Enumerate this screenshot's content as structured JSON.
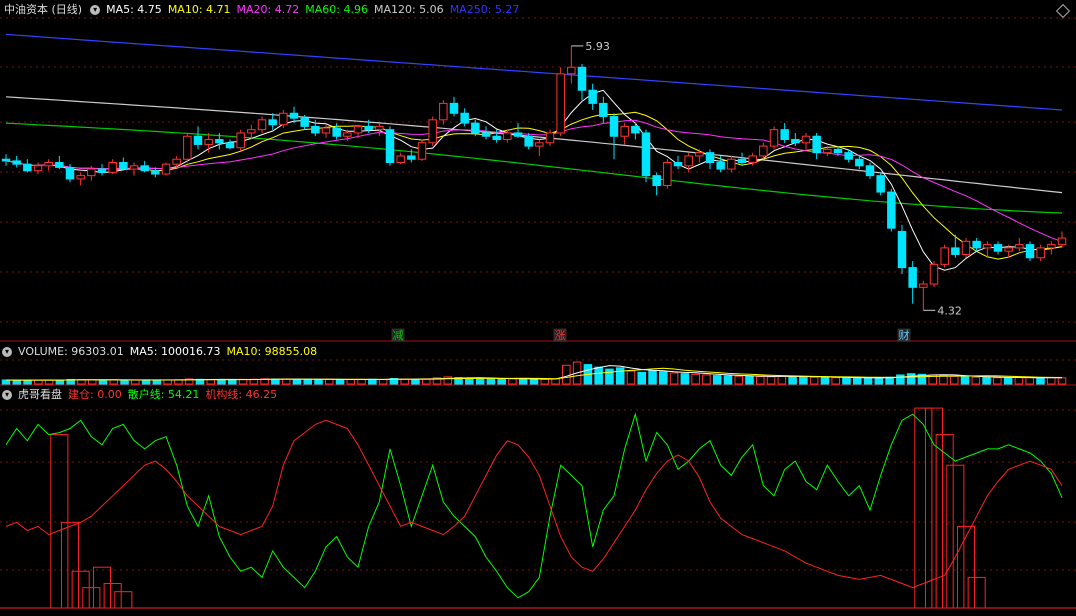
{
  "main": {
    "name": "中油资本 (日线)",
    "ma": [
      {
        "label": "MA5: 4.75",
        "color": "#ffffff"
      },
      {
        "label": "MA10: 4.71",
        "color": "#ffff00"
      },
      {
        "label": "MA20: 4.72",
        "color": "#ff33ff"
      },
      {
        "label": "MA60: 4.96",
        "color": "#00ff00"
      },
      {
        "label": "MA120: 5.06",
        "color": "#cccccc"
      },
      {
        "label": "MA250: 5.27",
        "color": "#3333ff"
      }
    ],
    "high_label": "5.93",
    "low_label": "4.32",
    "markers": [
      {
        "text": "减",
        "color": "#00cc00"
      },
      {
        "text": "涨",
        "color": "#ff3333"
      },
      {
        "text": "财",
        "color": "#66ccff"
      }
    ]
  },
  "volume": {
    "title": "VOLUME: 96303.01",
    "ma5": "MA5: 100016.73",
    "ma10": "MA10: 98855.08"
  },
  "indicator": {
    "title": "虎哥看盘",
    "jc": "建仓: 0.00",
    "sh": "散户线: 54.21",
    "jg": "机构线: 46.25"
  },
  "chart_data": [
    {
      "type": "candlestick",
      "title": "中油资本 (日线)",
      "ylim": [
        4.2,
        6.1
      ],
      "annotations": [
        {
          "label": "5.93",
          "value": 5.93
        },
        {
          "label": "4.32",
          "value": 4.32
        }
      ],
      "candles": [
        [
          5.24,
          5.27,
          5.2,
          5.23
        ],
        [
          5.23,
          5.26,
          5.19,
          5.21
        ],
        [
          5.21,
          5.24,
          5.16,
          5.17
        ],
        [
          5.17,
          5.22,
          5.15,
          5.2
        ],
        [
          5.2,
          5.24,
          5.17,
          5.22
        ],
        [
          5.22,
          5.26,
          5.18,
          5.19
        ],
        [
          5.19,
          5.21,
          5.1,
          5.12
        ],
        [
          5.12,
          5.16,
          5.08,
          5.14
        ],
        [
          5.14,
          5.2,
          5.11,
          5.18
        ],
        [
          5.18,
          5.21,
          5.14,
          5.16
        ],
        [
          5.16,
          5.24,
          5.15,
          5.22
        ],
        [
          5.22,
          5.25,
          5.17,
          5.18
        ],
        [
          5.18,
          5.22,
          5.14,
          5.2
        ],
        [
          5.2,
          5.23,
          5.16,
          5.17
        ],
        [
          5.17,
          5.19,
          5.13,
          5.15
        ],
        [
          5.15,
          5.22,
          5.14,
          5.21
        ],
        [
          5.21,
          5.26,
          5.19,
          5.24
        ],
        [
          5.24,
          5.4,
          5.22,
          5.38
        ],
        [
          5.38,
          5.44,
          5.3,
          5.33
        ],
        [
          5.33,
          5.4,
          5.28,
          5.36
        ],
        [
          5.36,
          5.4,
          5.3,
          5.34
        ],
        [
          5.34,
          5.36,
          5.3,
          5.31
        ],
        [
          5.31,
          5.42,
          5.29,
          5.4
        ],
        [
          5.4,
          5.45,
          5.36,
          5.42
        ],
        [
          5.42,
          5.5,
          5.4,
          5.48
        ],
        [
          5.48,
          5.52,
          5.42,
          5.45
        ],
        [
          5.45,
          5.54,
          5.43,
          5.52
        ],
        [
          5.52,
          5.56,
          5.46,
          5.49
        ],
        [
          5.49,
          5.51,
          5.42,
          5.44
        ],
        [
          5.44,
          5.48,
          5.38,
          5.4
        ],
        [
          5.4,
          5.45,
          5.37,
          5.43
        ],
        [
          5.43,
          5.46,
          5.36,
          5.38
        ],
        [
          5.38,
          5.42,
          5.35,
          5.4
        ],
        [
          5.4,
          5.45,
          5.37,
          5.44
        ],
        [
          5.44,
          5.48,
          5.4,
          5.42
        ],
        [
          5.42,
          5.46,
          5.38,
          5.44
        ],
        [
          5.42,
          5.44,
          5.2,
          5.22
        ],
        [
          5.22,
          5.28,
          5.21,
          5.26
        ],
        [
          5.26,
          5.3,
          5.22,
          5.24
        ],
        [
          5.24,
          5.36,
          5.23,
          5.34
        ],
        [
          5.34,
          5.5,
          5.32,
          5.48
        ],
        [
          5.48,
          5.6,
          5.45,
          5.58
        ],
        [
          5.58,
          5.62,
          5.5,
          5.52
        ],
        [
          5.52,
          5.55,
          5.44,
          5.46
        ],
        [
          5.46,
          5.48,
          5.38,
          5.4
        ],
        [
          5.4,
          5.44,
          5.36,
          5.38
        ],
        [
          5.38,
          5.42,
          5.34,
          5.36
        ],
        [
          5.36,
          5.42,
          5.34,
          5.4
        ],
        [
          5.4,
          5.46,
          5.37,
          5.38
        ],
        [
          5.38,
          5.4,
          5.3,
          5.32
        ],
        [
          5.32,
          5.36,
          5.26,
          5.34
        ],
        [
          5.34,
          5.42,
          5.32,
          5.4
        ],
        [
          5.4,
          5.8,
          5.38,
          5.76
        ],
        [
          5.76,
          5.93,
          5.7,
          5.8
        ],
        [
          5.8,
          5.82,
          5.6,
          5.66
        ],
        [
          5.66,
          5.7,
          5.54,
          5.58
        ],
        [
          5.58,
          5.62,
          5.46,
          5.5
        ],
        [
          5.5,
          5.52,
          5.24,
          5.38
        ],
        [
          5.38,
          5.46,
          5.33,
          5.44
        ],
        [
          5.44,
          5.46,
          5.36,
          5.4
        ],
        [
          5.4,
          5.42,
          5.1,
          5.14
        ],
        [
          5.14,
          5.16,
          5.02,
          5.08
        ],
        [
          5.08,
          5.24,
          5.06,
          5.22
        ],
        [
          5.22,
          5.26,
          5.18,
          5.2
        ],
        [
          5.2,
          5.28,
          5.16,
          5.26
        ],
        [
          5.26,
          5.3,
          5.22,
          5.28
        ],
        [
          5.28,
          5.3,
          5.18,
          5.22
        ],
        [
          5.22,
          5.26,
          5.16,
          5.18
        ],
        [
          5.18,
          5.26,
          5.16,
          5.24
        ],
        [
          5.24,
          5.28,
          5.2,
          5.22
        ],
        [
          5.22,
          5.28,
          5.2,
          5.26
        ],
        [
          5.26,
          5.34,
          5.24,
          5.32
        ],
        [
          5.32,
          5.44,
          5.3,
          5.42
        ],
        [
          5.42,
          5.46,
          5.34,
          5.36
        ],
        [
          5.36,
          5.4,
          5.32,
          5.34
        ],
        [
          5.34,
          5.4,
          5.3,
          5.38
        ],
        [
          5.38,
          5.4,
          5.24,
          5.28
        ],
        [
          5.28,
          5.32,
          5.26,
          5.3
        ],
        [
          5.3,
          5.32,
          5.26,
          5.28
        ],
        [
          5.28,
          5.3,
          5.22,
          5.24
        ],
        [
          5.24,
          5.26,
          5.18,
          5.2
        ],
        [
          5.2,
          5.22,
          5.12,
          5.14
        ],
        [
          5.14,
          5.16,
          5.02,
          5.04
        ],
        [
          5.04,
          5.06,
          4.8,
          4.82
        ],
        [
          4.8,
          4.84,
          4.54,
          4.58
        ],
        [
          4.58,
          4.62,
          4.36,
          4.46
        ],
        [
          4.46,
          4.5,
          4.32,
          4.48
        ],
        [
          4.48,
          4.62,
          4.46,
          4.6
        ],
        [
          4.6,
          4.72,
          4.58,
          4.7
        ],
        [
          4.7,
          4.78,
          4.64,
          4.66
        ],
        [
          4.66,
          4.76,
          4.64,
          4.74
        ],
        [
          4.74,
          4.76,
          4.68,
          4.7
        ],
        [
          4.7,
          4.74,
          4.64,
          4.72
        ],
        [
          4.72,
          4.74,
          4.66,
          4.68
        ],
        [
          4.68,
          4.72,
          4.64,
          4.7
        ],
        [
          4.7,
          4.76,
          4.68,
          4.72
        ],
        [
          4.72,
          4.74,
          4.62,
          4.64
        ],
        [
          4.64,
          4.72,
          4.62,
          4.7
        ],
        [
          4.7,
          4.74,
          4.66,
          4.72
        ],
        [
          4.72,
          4.8,
          4.7,
          4.76
        ]
      ],
      "ma_series": [
        {
          "name": "MA250",
          "values": [
            6.0,
            5.54
          ]
        },
        {
          "name": "MA120",
          "values": [
            5.62,
            5.06
          ]
        },
        {
          "name": "MA60",
          "values": [
            5.46,
            4.96
          ]
        }
      ]
    },
    {
      "type": "bar",
      "title": "VOLUME: 96303.01",
      "values": [
        62,
        60,
        58,
        61,
        63,
        62,
        70,
        66,
        64,
        62,
        65,
        60,
        61,
        63,
        60,
        62,
        66,
        78,
        72,
        70,
        68,
        65,
        72,
        74,
        80,
        76,
        78,
        74,
        70,
        68,
        72,
        70,
        68,
        70,
        72,
        70,
        85,
        76,
        72,
        80,
        95,
        110,
        98,
        90,
        84,
        80,
        78,
        82,
        80,
        76,
        72,
        78,
        290,
        340,
        300,
        260,
        230,
        250,
        200,
        180,
        200,
        190,
        170,
        160,
        150,
        140,
        130,
        125,
        120,
        118,
        115,
        112,
        125,
        120,
        110,
        105,
        100,
        98,
        96,
        94,
        92,
        95,
        105,
        140,
        160,
        150,
        140,
        130,
        120,
        110,
        105,
        100,
        98,
        96,
        100,
        98,
        96,
        100,
        96
      ]
    },
    {
      "type": "bar+line",
      "title": "虎哥看盘",
      "ylim": [
        0,
        100
      ],
      "series": [
        {
          "name": "建仓",
          "values": [
            0,
            0,
            0,
            0,
            0,
            0,
            0,
            0,
            0,
            0,
            0,
            0,
            0,
            0,
            0,
            0,
            0,
            0,
            0,
            0,
            0,
            0,
            0,
            0,
            0,
            0,
            0,
            0,
            0,
            0,
            0,
            0,
            0,
            0,
            0,
            0,
            0,
            0,
            0,
            0,
            0,
            0,
            0,
            0,
            0,
            0,
            0,
            0,
            0,
            0,
            0,
            0,
            0,
            0,
            0,
            0,
            0,
            0,
            0,
            0,
            0,
            0,
            0,
            0,
            0,
            0,
            0,
            0,
            0,
            0,
            0,
            0,
            0,
            0,
            0,
            0,
            0,
            0,
            0,
            0,
            0,
            0,
            0,
            0,
            0,
            0,
            0,
            0,
            0,
            0,
            0,
            0,
            0,
            0,
            0,
            0,
            0,
            0,
            0,
            0
          ]
        },
        {
          "name": "散户线",
          "values": [
            80,
            88,
            82,
            90,
            85,
            86,
            88,
            92,
            84,
            80,
            88,
            90,
            82,
            78,
            82,
            84,
            70,
            50,
            40,
            55,
            35,
            25,
            18,
            20,
            15,
            28,
            20,
            15,
            10,
            18,
            30,
            35,
            25,
            20,
            40,
            52,
            78,
            60,
            40,
            55,
            70,
            52,
            45,
            40,
            35,
            25,
            18,
            10,
            5,
            8,
            15,
            45,
            70,
            65,
            60,
            30,
            48,
            55,
            78,
            95,
            72,
            86,
            80,
            68,
            72,
            78,
            82,
            70,
            65,
            74,
            80,
            60,
            55,
            68,
            72,
            62,
            58,
            70,
            62,
            55,
            60,
            48,
            65,
            80,
            92,
            95,
            90,
            80,
            76,
            72,
            74,
            76,
            78,
            78,
            80,
            78,
            76,
            72,
            66,
            54
          ]
        },
        {
          "name": "机构线",
          "values": [
            40,
            42,
            38,
            40,
            36,
            38,
            40,
            42,
            45,
            50,
            55,
            60,
            65,
            70,
            72,
            68,
            62,
            55,
            50,
            45,
            40,
            38,
            36,
            38,
            40,
            50,
            70,
            82,
            86,
            90,
            92,
            90,
            88,
            80,
            70,
            60,
            50,
            40,
            42,
            40,
            38,
            36,
            40,
            45,
            55,
            65,
            75,
            82,
            80,
            74,
            65,
            50,
            35,
            25,
            20,
            18,
            24,
            32,
            40,
            48,
            58,
            66,
            72,
            75,
            72,
            64,
            52,
            44,
            40,
            36,
            34,
            32,
            30,
            28,
            25,
            22,
            20,
            18,
            16,
            15,
            14,
            15,
            16,
            14,
            12,
            10,
            12,
            14,
            16,
            25,
            35,
            45,
            55,
            62,
            68,
            70,
            72,
            70,
            68,
            60
          ]
        }
      ],
      "bars": [
        {
          "value": 85
        },
        {
          "value": 42
        },
        {
          "value": 18
        },
        {
          "value": 10
        },
        {
          "value": 20
        },
        {
          "value": 12
        },
        {
          "value": 8
        },
        {
          "value": 98
        },
        {
          "value": 98
        },
        {
          "value": 85
        },
        {
          "value": 70
        },
        {
          "value": 40
        },
        {
          "value": 15
        }
      ]
    }
  ]
}
